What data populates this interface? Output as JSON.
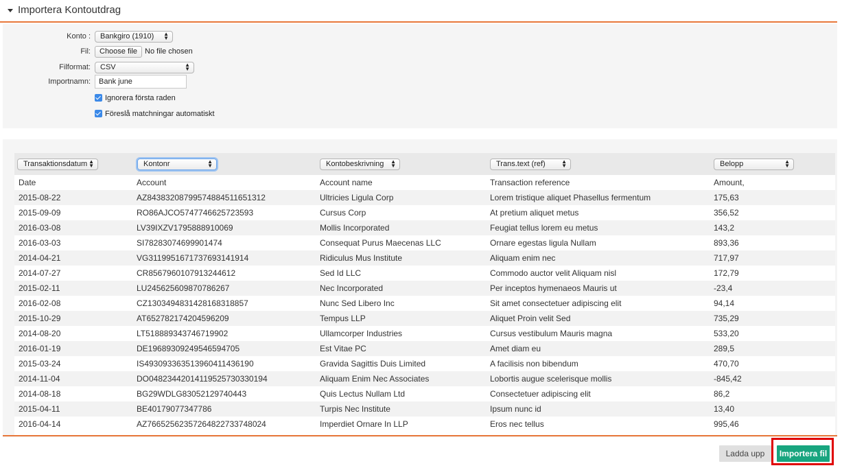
{
  "header": {
    "title": "Importera Kontoutdrag"
  },
  "form": {
    "konto_label": "Konto :",
    "konto_value": "Bankgiro (1910)",
    "fil_label": "Fil:",
    "file_button": "Choose file",
    "file_status": "No file chosen",
    "filformat_label": "Filformat:",
    "filformat_value": "CSV",
    "importnamn_label": "Importnamn:",
    "importnamn_value": "Bank june",
    "ignore_first_row": {
      "label": "Ignorera första raden",
      "checked": true
    },
    "auto_match": {
      "label": "Föreslå matchningar automatiskt",
      "checked": true
    }
  },
  "table": {
    "mapping": [
      "Transaktionsdatum",
      "Kontonr",
      "Kontobeskrivning",
      "Trans.text (ref)",
      "Belopp"
    ],
    "headers": [
      "Date",
      "Account",
      "Account name",
      "Transaction reference",
      "Amount,"
    ],
    "rows": [
      [
        "2015-08-22",
        "AZ84383208799574884511651312",
        "Ultricies Ligula Corp",
        "Lorem tristique aliquet Phasellus fermentum",
        "175,63"
      ],
      [
        "2015-09-09",
        "RO86AJCO5747746625723593",
        "Cursus Corp",
        "At pretium aliquet metus",
        "356,52"
      ],
      [
        "2016-03-08",
        "LV39IXZV1795888910069",
        "Mollis Incorporated",
        "Feugiat tellus lorem eu metus",
        "143,2"
      ],
      [
        "2016-03-03",
        "SI78283074699901474",
        "Consequat Purus Maecenas LLC",
        "Ornare egestas ligula Nullam",
        "893,36"
      ],
      [
        "2014-04-21",
        "VG3119951671737693141914",
        "Ridiculus Mus Institute",
        "Aliquam enim nec",
        "717,97"
      ],
      [
        "2014-07-27",
        "CR8567960107913244612",
        "Sed Id LLC",
        "Commodo auctor velit Aliquam nisl",
        "172,79"
      ],
      [
        "2015-02-11",
        "LU245625609870786267",
        "Nec Incorporated",
        "Per inceptos hymenaeos Mauris ut",
        "-23,4"
      ],
      [
        "2016-02-08",
        "CZ1303494831428168318857",
        "Nunc Sed Libero Inc",
        "Sit amet consectetuer adipiscing elit",
        "94,14"
      ],
      [
        "2015-10-29",
        "AT652782174204596209",
        "Tempus LLP",
        "Aliquet Proin velit Sed",
        "735,29"
      ],
      [
        "2014-08-20",
        "LT518889343746719902",
        "Ullamcorper Industries",
        "Cursus vestibulum Mauris magna",
        "533,20"
      ],
      [
        "2016-01-19",
        "DE19689309249546594705",
        "Est Vitae PC",
        "Amet diam eu",
        "289,5"
      ],
      [
        "2015-03-24",
        "IS493093363513960411436190",
        "Gravida Sagittis Duis Limited",
        "A facilisis non bibendum",
        "470,70"
      ],
      [
        "2014-11-04",
        "DO04823442014119525730330194",
        "Aliquam Enim Nec Associates",
        "Lobortis augue scelerisque mollis",
        "-845,42"
      ],
      [
        "2014-08-18",
        "BG29WDLG83052129740443",
        "Quis Lectus Nullam Ltd",
        "Consectetuer adipiscing elit",
        "86,2"
      ],
      [
        "2015-04-11",
        "BE40179077347786",
        "Turpis Nec Institute",
        "Ipsum nunc id",
        "13,40"
      ],
      [
        "2016-04-14",
        "AZ76652562357264822733748024",
        "Imperdiet Ornare In LLP",
        "Eros nec tellus",
        "995,46"
      ]
    ]
  },
  "footer": {
    "upload_label": "Ladda upp",
    "import_label": "Importera fil"
  },
  "colors": {
    "accent": "#e8773a",
    "primary_button": "#18a57f",
    "highlight_box": "#e00000",
    "checkbox": "#3b89e8"
  }
}
